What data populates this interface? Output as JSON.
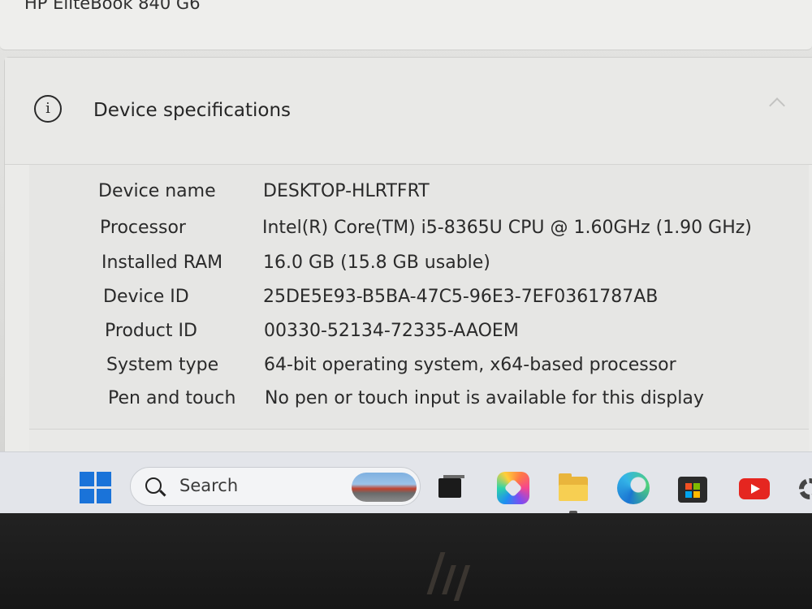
{
  "window": {
    "device_model": "HP EliteBook 840 G6"
  },
  "device_specifications": {
    "section_title": "Device specifications",
    "rows": [
      {
        "label": "Device name",
        "value": "DESKTOP-HLRTFRT"
      },
      {
        "label": "Processor",
        "value": "Intel(R) Core(TM) i5-8365U CPU @ 1.60GHz (1.90 GHz)"
      },
      {
        "label": "Installed RAM",
        "value": "16.0 GB (15.8 GB usable)"
      },
      {
        "label": "Device ID",
        "value": "25DE5E93-B5BA-47C5-96E3-7EF0361787AB"
      },
      {
        "label": "Product ID",
        "value": "00330-52134-72335-AAOEM"
      },
      {
        "label": "System type",
        "value": "64-bit operating system, x64-based processor"
      },
      {
        "label": "Pen and touch",
        "value": "No pen or touch input is available for this display"
      }
    ]
  },
  "taskbar": {
    "search_label": "Search",
    "icons": [
      "start-icon",
      "search-icon",
      "task-view-icon",
      "copilot-icon",
      "file-explorer-icon",
      "edge-icon",
      "microsoft-store-icon",
      "youtube-icon",
      "settings-icon"
    ],
    "active_app": "file-explorer-icon"
  },
  "bezel": {
    "logo": "hp"
  }
}
